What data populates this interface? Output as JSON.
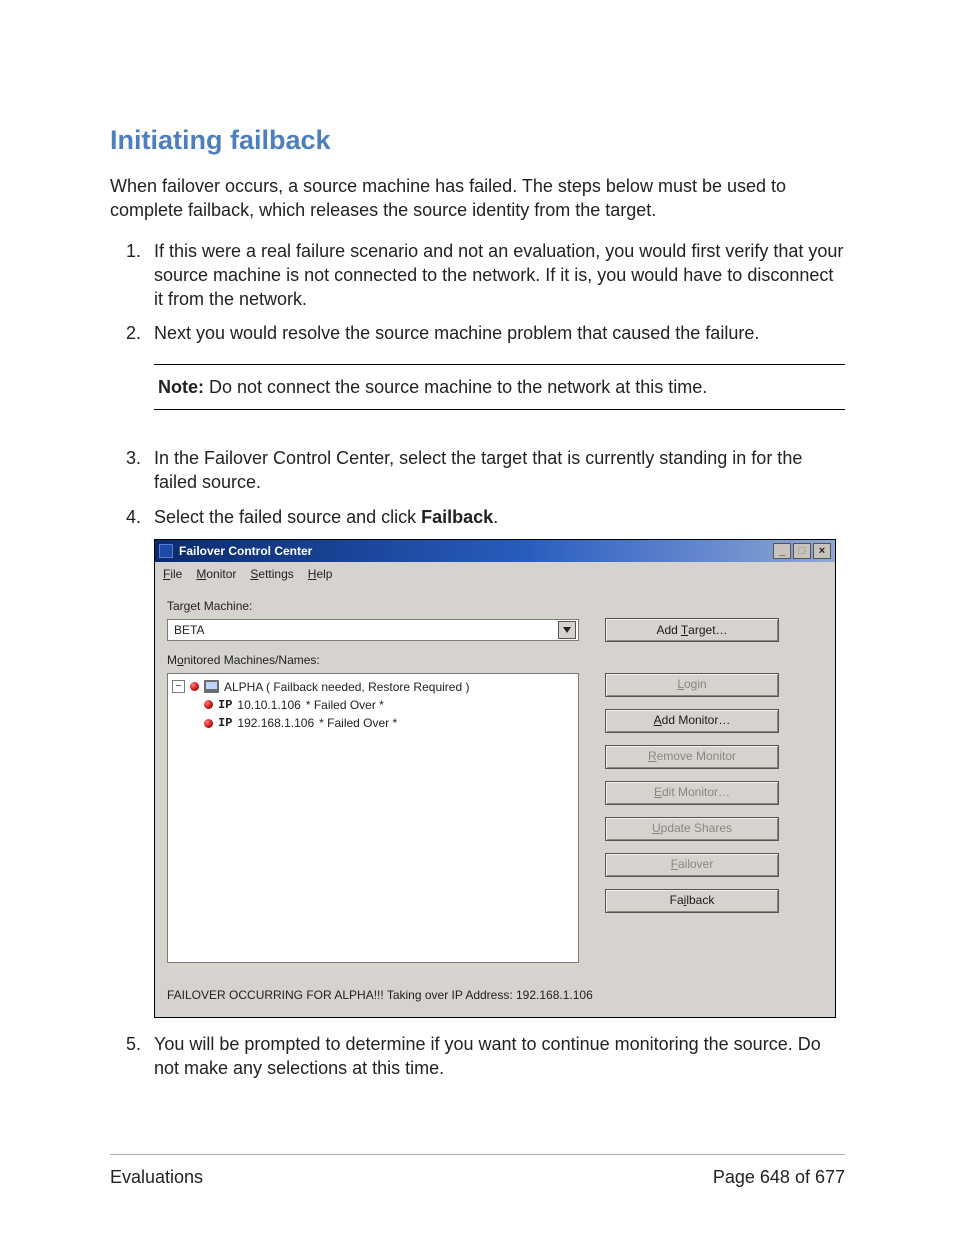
{
  "doc": {
    "title": "Initiating failback",
    "intro": "When failover occurs, a source machine has failed. The steps below must be used to complete failback, which releases the source identity from the target.",
    "steps": {
      "s1": "If this were a real failure scenario and not an evaluation, you would first verify that your source machine is not connected to the network. If it is, you would have to disconnect it from the network.",
      "s2": "Next you would resolve the source machine problem that caused the failure.",
      "s3": "In the Failover Control Center, select the target that is currently standing in for the failed source.",
      "s4_pre": "Select the failed source and click ",
      "s4_bold": "Failback",
      "s4_post": ".",
      "s5": "You will be prompted to determine if you want to continue monitoring the source. Do not make any selections at this time."
    },
    "note": {
      "label": "Note:",
      "text": "  Do not connect the source machine to the network at this time."
    }
  },
  "win": {
    "title": "Failover Control Center",
    "menu": {
      "file": "File",
      "monitor": "Monitor",
      "settings": "Settings",
      "help": "Help"
    },
    "label_target": "Target Machine:",
    "target_value": "BETA",
    "label_monitored": "Monitored Machines/Names:",
    "tree": {
      "root_toggle": "−",
      "root_text": "ALPHA ( Failback needed, Restore Required )",
      "ip1": "10.10.1.106",
      "ip1_status": "  * Failed Over *",
      "ip2": "192.168.1.106",
      "ip2_status": "  * Failed Over *",
      "ip_label": "IP"
    },
    "buttons": {
      "add_target": "Add Target…",
      "login": "Login",
      "add_monitor": "Add Monitor…",
      "remove_monitor": "Remove Monitor",
      "edit_monitor": "Edit Monitor…",
      "update_shares": "Update Shares",
      "failover": "Failover",
      "failback": "Failback"
    },
    "status": "FAILOVER OCCURRING FOR ALPHA!!!  Taking over IP Address: 192.168.1.106"
  },
  "footer": {
    "left": "Evaluations",
    "right": "Page 648 of 677"
  }
}
